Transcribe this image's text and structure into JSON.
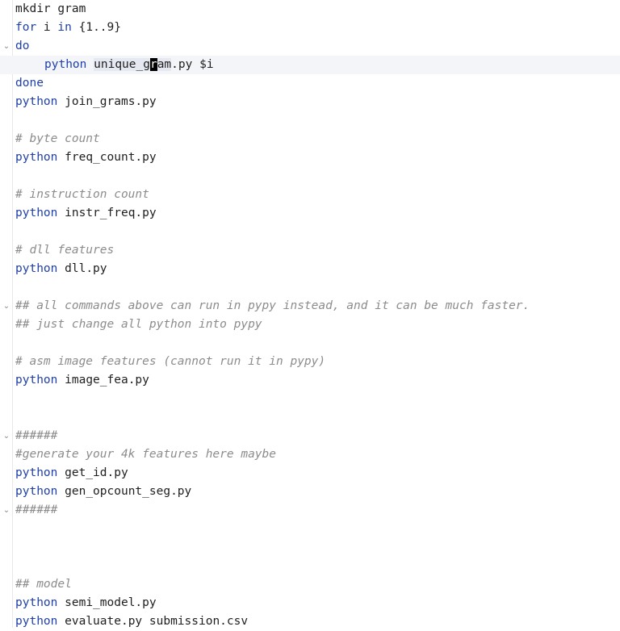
{
  "lines": [
    {
      "kind": "plain",
      "text": "mkdir gram"
    },
    {
      "kind": "for",
      "kw": "for",
      "mid": " i ",
      "kw2": "in",
      "rest": " {1..9}"
    },
    {
      "kind": "kwonly",
      "kw": "do",
      "fold": "⌄"
    },
    {
      "kind": "current",
      "kw": "python",
      "pre": "unique_g",
      "caret": "r",
      "post": "am",
      "rest": ".py $i"
    },
    {
      "kind": "kwonly",
      "kw": "done"
    },
    {
      "kind": "cmd",
      "kw": "python",
      "arg": "join_grams.py"
    },
    {
      "kind": "blank"
    },
    {
      "kind": "comment",
      "text": "# byte count"
    },
    {
      "kind": "cmd",
      "kw": "python",
      "arg": "freq_count.py"
    },
    {
      "kind": "blank"
    },
    {
      "kind": "comment",
      "text": "# instruction count"
    },
    {
      "kind": "cmd",
      "kw": "python",
      "arg": "instr_freq.py"
    },
    {
      "kind": "blank"
    },
    {
      "kind": "comment",
      "text": "# dll features"
    },
    {
      "kind": "cmd",
      "kw": "python",
      "arg": "dll.py"
    },
    {
      "kind": "blank"
    },
    {
      "kind": "comment",
      "text": "## all commands above can run in pypy instead, and it can be much faster.",
      "fold": "⌄"
    },
    {
      "kind": "comment",
      "text": "## just change all python into pypy"
    },
    {
      "kind": "blank"
    },
    {
      "kind": "comment",
      "text": "# asm image features (cannot run it in pypy)"
    },
    {
      "kind": "cmd",
      "kw": "python",
      "arg": "image_fea.py"
    },
    {
      "kind": "blank"
    },
    {
      "kind": "blank"
    },
    {
      "kind": "comment",
      "text": "######",
      "fold": "⌄"
    },
    {
      "kind": "comment",
      "text": "#generate your 4k features here maybe"
    },
    {
      "kind": "cmd",
      "kw": "python",
      "arg": "get_id.py"
    },
    {
      "kind": "cmd",
      "kw": "python",
      "arg": "gen_opcount_seg.py"
    },
    {
      "kind": "comment",
      "text": "######",
      "fold": "⌄"
    },
    {
      "kind": "blank"
    },
    {
      "kind": "blank"
    },
    {
      "kind": "blank"
    },
    {
      "kind": "comment",
      "text": "## model"
    },
    {
      "kind": "cmd",
      "kw": "python",
      "arg": "semi_model.py"
    },
    {
      "kind": "cmd",
      "kw": "python",
      "arg": "evaluate.py submission.csv"
    }
  ]
}
